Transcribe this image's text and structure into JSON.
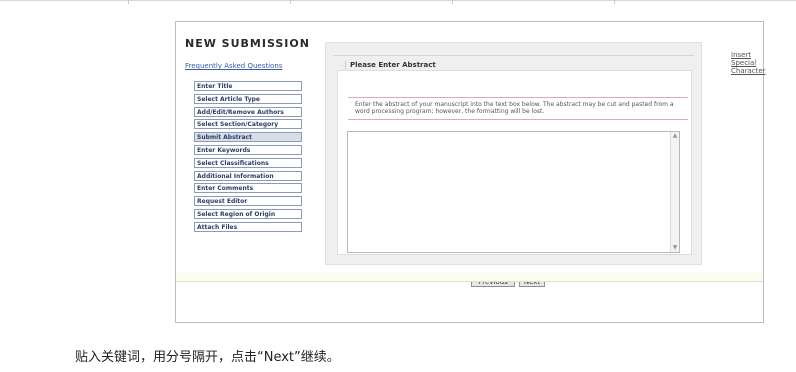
{
  "form": {
    "title": "NEW SUBMISSION",
    "faq_link": "Frequently Asked Questions",
    "special_char_link": "Insert Special Character",
    "section_legend": "Please Enter Abstract",
    "instructions": "Enter the abstract of your manuscript into the text box below. The abstract may be cut and pasted from a word processing program; however, the formatting will be lost.",
    "abstract_value": "",
    "previous_label": "Previous",
    "next_label": "Next"
  },
  "steps": [
    {
      "label": "Enter Title",
      "status": "done"
    },
    {
      "label": "Select Article Type",
      "status": "done"
    },
    {
      "label": "Add/Edit/Remove Authors",
      "status": ""
    },
    {
      "label": "Select Section/Category",
      "status": ""
    },
    {
      "label": "Submit Abstract",
      "status": "current"
    },
    {
      "label": "Enter Keywords",
      "status": ""
    },
    {
      "label": "Select Classifications",
      "status": ""
    },
    {
      "label": "Additional Information",
      "status": ""
    },
    {
      "label": "Enter Comments",
      "status": ""
    },
    {
      "label": "Request Editor",
      "status": ""
    },
    {
      "label": "Select Region of Origin",
      "status": ""
    },
    {
      "label": "Attach Files",
      "status": ""
    }
  ],
  "caption": "贴入关键词，用分号隔开，点击“Next”继续。",
  "colors": {
    "step_border": "#8a9bb5",
    "step_text": "#2a3d6a",
    "check": "#3a66b0",
    "red_rule": "#e8a8a8"
  }
}
